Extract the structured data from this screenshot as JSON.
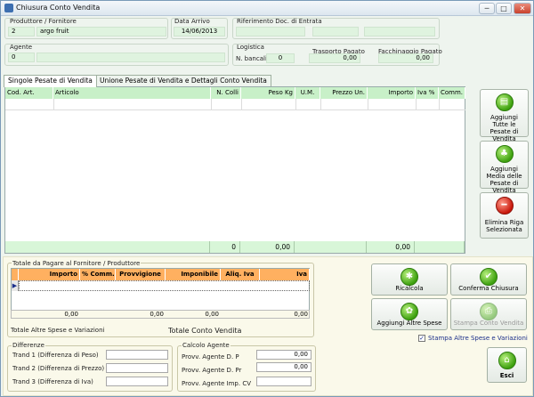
{
  "window": {
    "title": "Chiusura Conto Vendita",
    "minimize": "─",
    "maximize": "□",
    "close": "✕"
  },
  "producer": {
    "label": "Produttore / Fornitore",
    "code": "2",
    "name": "argo fruit"
  },
  "arrival": {
    "label": "Data Arrivo",
    "date": "14/06/2013"
  },
  "reference": {
    "label": "Riferimento Doc. di Entrata"
  },
  "agent": {
    "label": "Agente",
    "code": "0"
  },
  "logistics": {
    "label": "Logistica",
    "bancali_label": "N. bancali",
    "bancali_value": "0",
    "transport_label": "Trasporto Pagato",
    "transport_value": "0,00",
    "packing_label": "Facchinaggio Pagato",
    "packing_value": "0,00"
  },
  "tabs": [
    "Singole Pesate di Vendita",
    "Unione Pesate di Vendita e Dettagli Conto Vendita"
  ],
  "grid": {
    "columns": [
      "Cod. Art.",
      "Articolo",
      "N. Colli",
      "Peso Kg",
      "U.M.",
      "Prezzo Un.",
      "Importo",
      "Iva %",
      "Comm."
    ],
    "totals": {
      "colli": "0",
      "peso": "0,00",
      "importo": "0,00"
    }
  },
  "side_buttons": [
    {
      "label": "Aggiungi Tutte le Pesate di Vendita",
      "icon": "page-icon"
    },
    {
      "label": "Aggiungi Media delle Pesate di Vendita",
      "icon": "tree-icon"
    },
    {
      "label": "Elimina Riga Selezionata",
      "icon": "minus-icon"
    }
  ],
  "totals_box": {
    "label": "Totale da Pagare al Fornitore / Produttore",
    "columns": [
      "Importo",
      "% Comm.",
      "Provvigione",
      "Imponibile",
      "Aliq. Iva",
      "Iva"
    ],
    "sums": [
      "0,00",
      "0,00",
      "0,00",
      "0,00"
    ],
    "other_expenses_label": "Totale Altre Spese e Variazioni",
    "conto_label": "Totale Conto Vendita"
  },
  "actions": {
    "ricalcola": "Ricalcola",
    "conferma": "Conferma Chiusura",
    "altre_spese": "Aggiungi Altre Spese",
    "stampa": "Stampa Conto Vendita",
    "stampa_check": "Stampa Altre Spese e Variazioni",
    "esci": "Esci"
  },
  "differences": {
    "label": "Differenze",
    "items": [
      "Trand 1 (Differenza di Peso)",
      "Trand 2 (Differenza di Prezzo)",
      "Trand 3 (Differenza di Iva)"
    ]
  },
  "agent_calc": {
    "label": "Calcolo Agente",
    "items": [
      {
        "label": "Provv. Agente D. P",
        "value": "0,00"
      },
      {
        "label": "Provv. Agente D. Pr",
        "value": "0,00"
      },
      {
        "label": "Provv. Agente Imp. CV",
        "value": ""
      }
    ]
  },
  "colors": {
    "accent_green": "#c8f0c8",
    "header_orange": "#ffb060",
    "close_red": "#c8412c"
  }
}
